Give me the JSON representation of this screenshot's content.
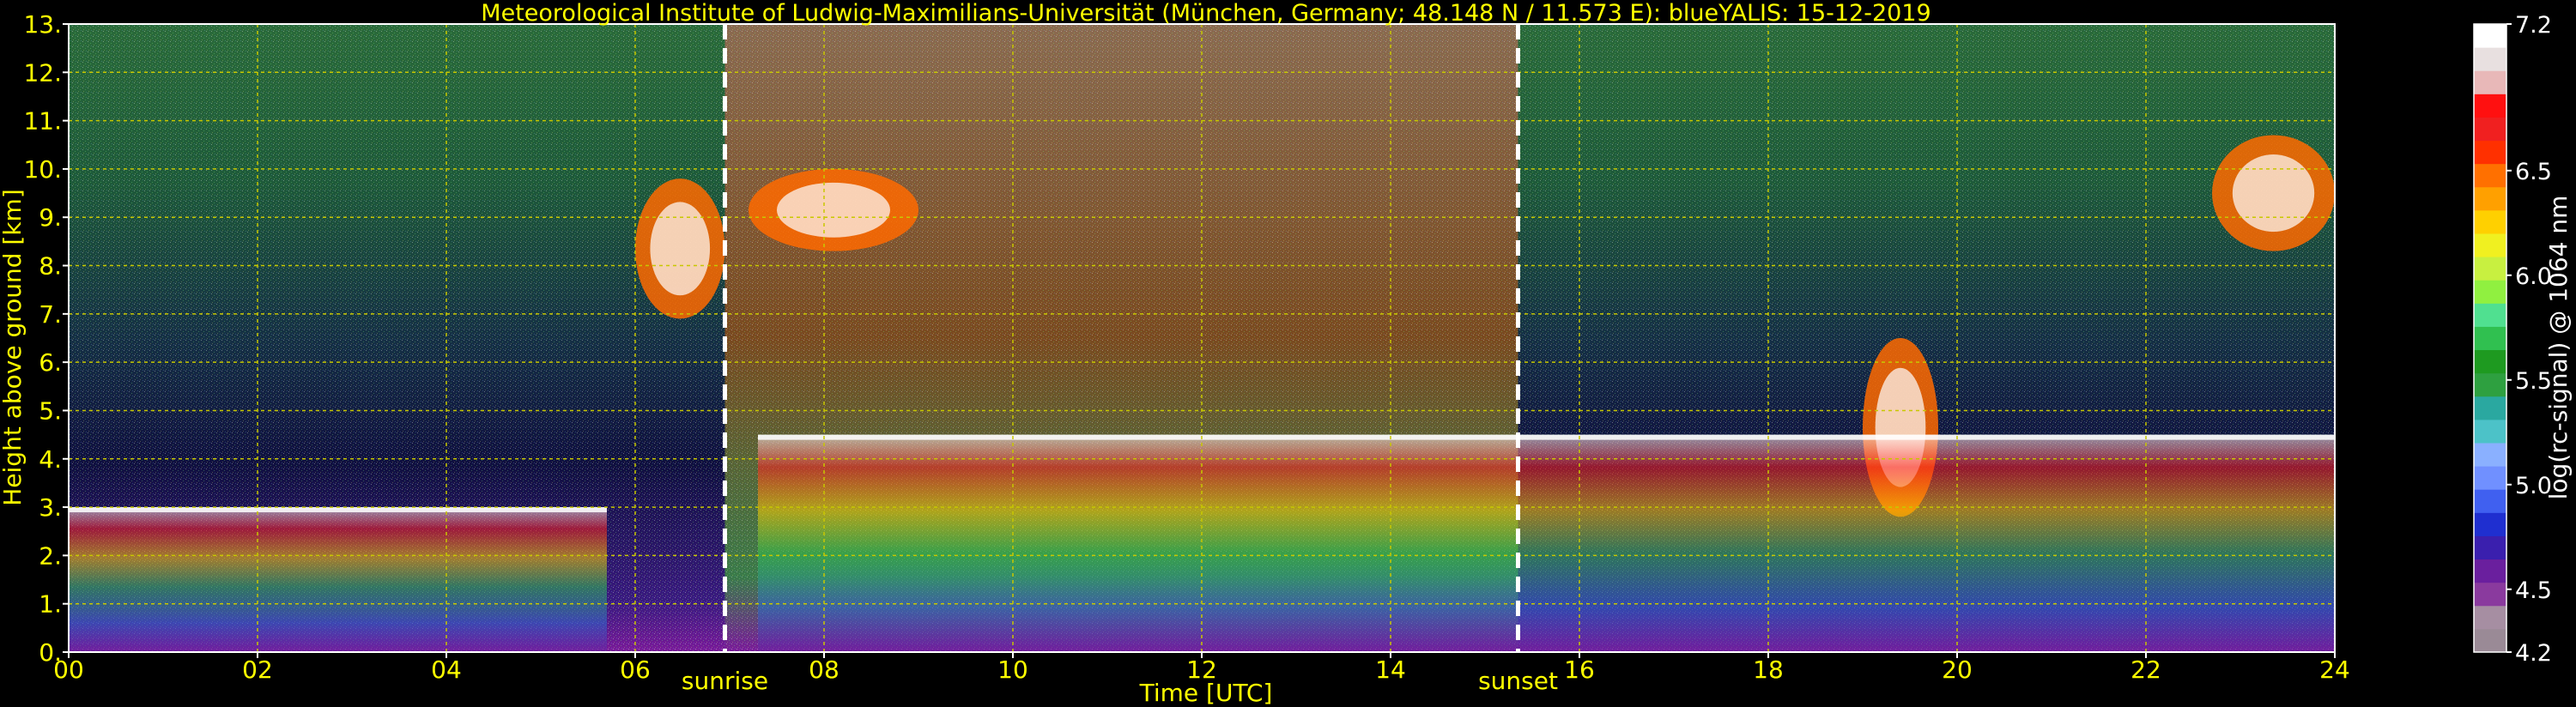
{
  "chart_data": {
    "type": "heatmap",
    "title": "Meteorological Institute of Ludwig-Maximilians-Universität (München, Germany; 48.148 N / 11.573 E):     blueYALIS: 15-12-2019",
    "xlabel": "Time [UTC]",
    "ylabel": "Height above ground [km]",
    "xlim": [
      0,
      24
    ],
    "ylim": [
      0,
      13
    ],
    "x_ticks": [
      0,
      2,
      4,
      6,
      8,
      10,
      12,
      14,
      16,
      18,
      20,
      22,
      24
    ],
    "x_tick_labels": [
      "00",
      "02",
      "04",
      "06",
      "08",
      "10",
      "12",
      "14",
      "16",
      "18",
      "20",
      "22",
      "24"
    ],
    "y_ticks": [
      0,
      1,
      2,
      3,
      4,
      5,
      6,
      7,
      8,
      9,
      10,
      11,
      12,
      13
    ],
    "y_tick_labels": [
      "0.",
      "1.",
      "2.",
      "3.",
      "4.",
      "5.",
      "6.",
      "7.",
      "8.",
      "9.",
      "10.",
      "11.",
      "12.",
      "13."
    ],
    "grid": true,
    "annotations": [
      {
        "label": "sunrise",
        "x": 6.95
      },
      {
        "label": "sunset",
        "x": 15.35
      }
    ],
    "colorbar": {
      "label": "log(rc-signal) @ 1064 nm",
      "range": [
        4.2,
        7.2
      ],
      "ticks": [
        4.2,
        4.5,
        5.0,
        5.5,
        6.0,
        6.5,
        7.2
      ],
      "tick_labels": [
        "4.2",
        "4.5",
        "5.0",
        "5.5",
        "6.0",
        "6.5",
        "7.2"
      ],
      "colors": [
        "#9a8a96",
        "#a68ea2",
        "#8a3a9e",
        "#6a1f9e",
        "#3a1fae",
        "#1f2fd0",
        "#4060f0",
        "#7090ff",
        "#8ab0ff",
        "#4cc2c8",
        "#2aa8a0",
        "#2ea040",
        "#1e9a20",
        "#30c050",
        "#50e090",
        "#90f040",
        "#c8f040",
        "#f0f020",
        "#ffd000",
        "#ffa000",
        "#ff7000",
        "#ff3000",
        "#f02020",
        "#ff1010",
        "#e8b8b8",
        "#e8e0e0",
        "#ffffff"
      ]
    },
    "features": [
      {
        "kind": "cloud",
        "time": [
          6.0,
          6.95
        ],
        "height": [
          6.9,
          9.8
        ]
      },
      {
        "kind": "cloud",
        "time": [
          7.2,
          9.0
        ],
        "height": [
          8.3,
          10.0
        ]
      },
      {
        "kind": "cloud",
        "time": [
          22.7,
          24.0
        ],
        "height": [
          8.3,
          10.7
        ]
      },
      {
        "kind": "cloud",
        "time": [
          19.0,
          19.8
        ],
        "height": [
          2.8,
          6.5
        ]
      },
      {
        "kind": "boundary_layer_top",
        "time": [
          0.0,
          5.7
        ],
        "height": [
          1.8,
          3.0
        ]
      },
      {
        "kind": "boundary_layer_top",
        "time": [
          7.3,
          15.3
        ],
        "height": [
          2.3,
          4.5
        ]
      },
      {
        "kind": "boundary_layer_top",
        "time": [
          15.3,
          24.0
        ],
        "height": [
          2.5,
          4.5
        ]
      }
    ]
  }
}
